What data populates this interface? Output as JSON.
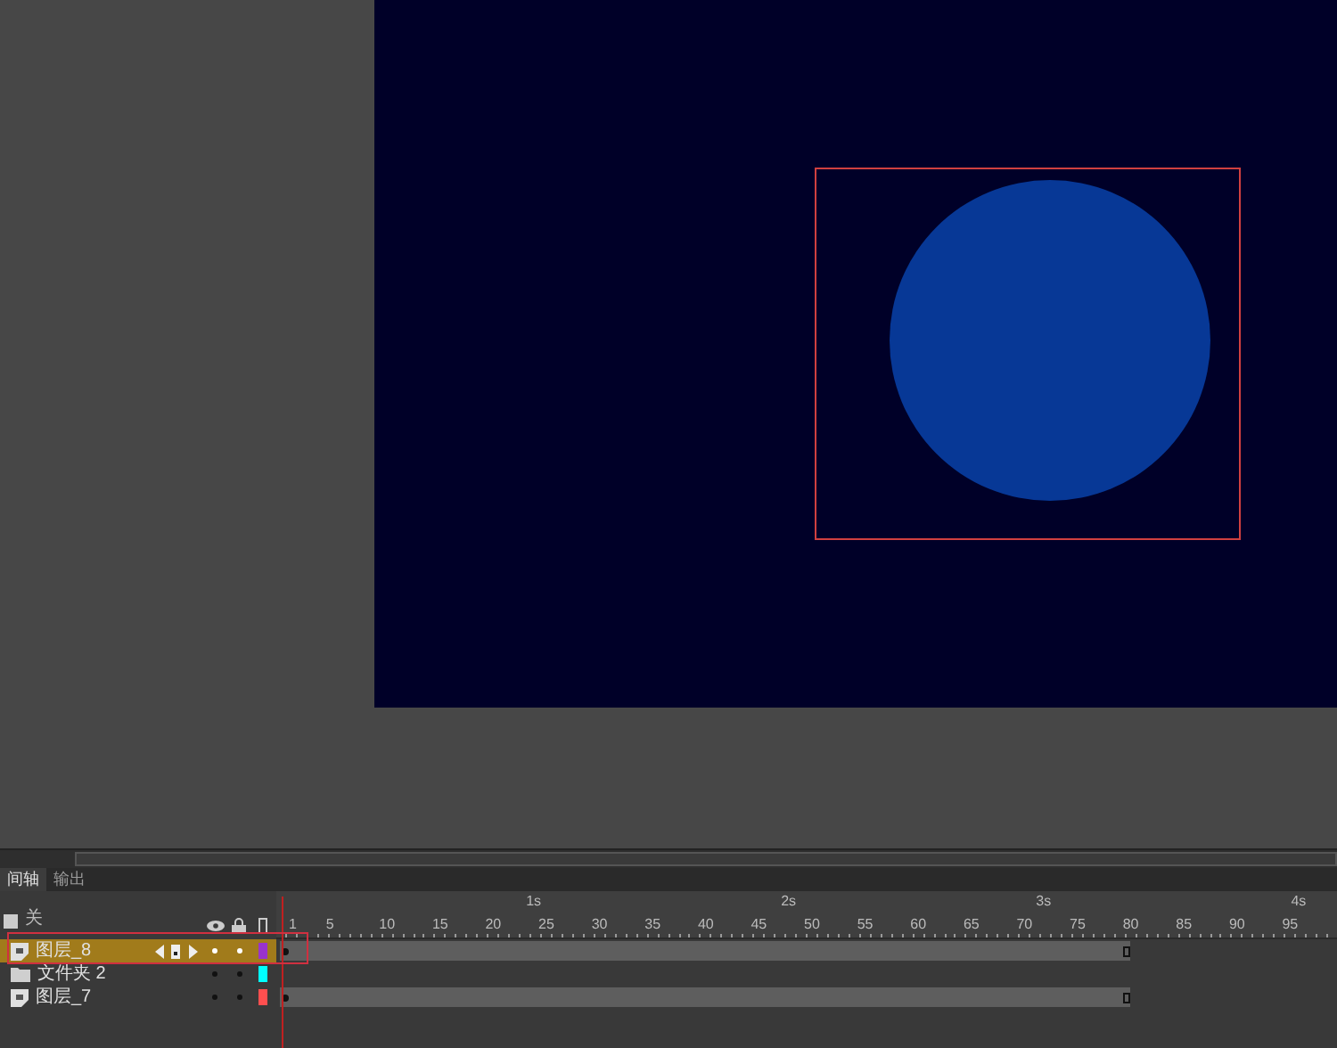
{
  "timeline": {
    "tabs": [
      {
        "label": "间轴",
        "selected": true
      },
      {
        "label": "输出",
        "selected": false
      }
    ],
    "header": {
      "label": "关"
    },
    "frame_labels": [
      "1",
      "5",
      "10",
      "15",
      "20",
      "25",
      "30",
      "35",
      "40",
      "45",
      "50",
      "55",
      "60",
      "65",
      "70",
      "75",
      "80",
      "85",
      "90",
      "95"
    ],
    "second_labels": [
      "1s",
      "2s",
      "3s",
      "4s"
    ],
    "layers": [
      {
        "kind": "layer",
        "name": "图层_8",
        "selected": true,
        "color": "#9933cc"
      },
      {
        "kind": "folder",
        "name": "文件夹 2",
        "selected": false,
        "color": "#00ffff"
      },
      {
        "kind": "layer",
        "name": "图层_7",
        "selected": false,
        "color": "#ff4f4f"
      }
    ]
  }
}
